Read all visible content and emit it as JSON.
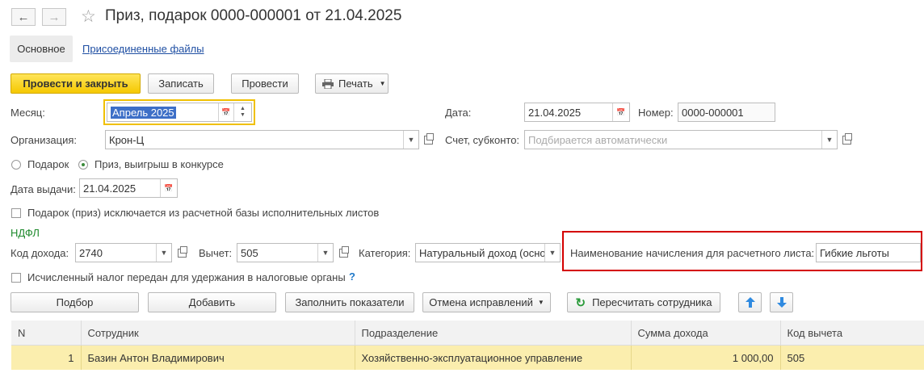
{
  "window": {
    "title": "Приз, подарок 0000-000001 от 21.04.2025"
  },
  "tabs": {
    "main": "Основное",
    "files": "Присоединенные файлы"
  },
  "toolbar": {
    "post_close": "Провести и закрыть",
    "save": "Записать",
    "post": "Провести",
    "print": "Печать"
  },
  "form": {
    "month_label": "Месяц:",
    "month_value": "Апрель 2025",
    "date_label": "Дата:",
    "date_value": "21.04.2025",
    "number_label": "Номер:",
    "number_value": "0000-000001",
    "org_label": "Организация:",
    "org_value": "Крон-Ц",
    "account_label": "Счет, субконто:",
    "account_placeholder": "Подбирается автоматически",
    "radio_gift": "Подарок",
    "radio_prize": "Приз, выигрыш в конкурсе",
    "issue_date_label": "Дата выдачи:",
    "issue_date_value": "21.04.2025",
    "exclude_check": "Подарок (приз) исключается из расчетной базы исполнительных листов"
  },
  "ndfl": {
    "heading": "НДФЛ",
    "income_code_label": "Код дохода:",
    "income_code_value": "2740",
    "deduction_label": "Вычет:",
    "deduction_value": "505",
    "category_label": "Категория:",
    "category_value": "Натуральный доход (осно",
    "accrual_name_label": "Наименование начисления для расчетного листа:",
    "accrual_name_value": "Гибкие льготы",
    "tax_transferred_check": "Исчисленный налог передан для удержания в налоговые органы",
    "help": "?"
  },
  "table_toolbar": {
    "select": "Подбор",
    "add": "Добавить",
    "fill": "Заполнить показатели",
    "cancel_fix": "Отмена исправлений",
    "recalc": "Пересчитать сотрудника"
  },
  "table": {
    "columns": [
      "N",
      "Сотрудник",
      "Подразделение",
      "Сумма дохода",
      "Код вычета"
    ],
    "rows": [
      {
        "n": "1",
        "employee": "Базин Антон Владимирович",
        "department": "Хозяйственно-эксплуатационное управление",
        "amount": "1 000,00",
        "code": "505"
      }
    ]
  },
  "colors": {
    "accent_yellow": "#f5c800",
    "highlight_red": "#d40000",
    "link_blue": "#1f4fa3",
    "ndfl_green": "#1e8a2d",
    "selected_row": "#fbeeae"
  }
}
